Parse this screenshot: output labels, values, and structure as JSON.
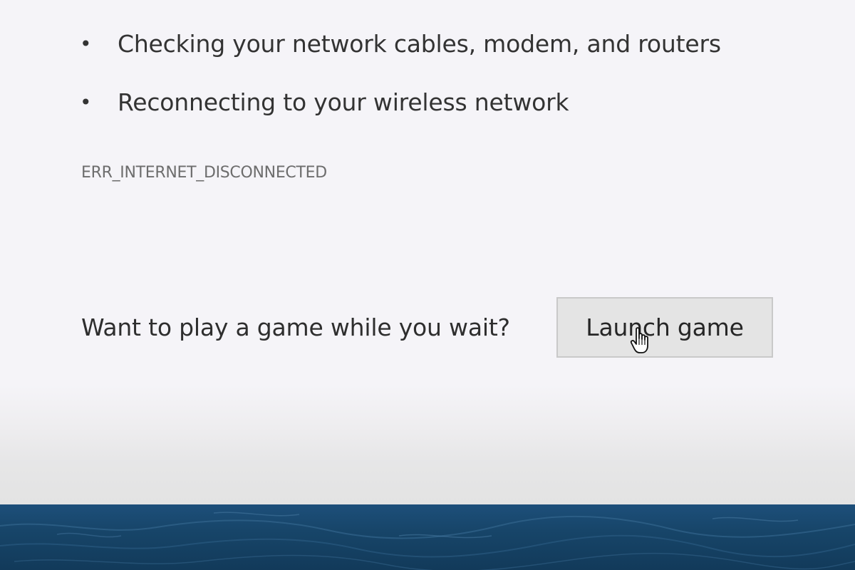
{
  "page": {
    "suggestions": [
      "Checking your network cables, modem, and routers",
      "Reconnecting to your wireless network"
    ],
    "bullet_char": "•",
    "error_code": "ERR_INTERNET_DISCONNECTED",
    "game_prompt": "Want to play a game while you wait?",
    "launch_button_label": "Launch game"
  },
  "colors": {
    "page_background": "#f5f4f8",
    "text": "#333333",
    "error_code_text": "#6d6d6d",
    "button_background": "#e4e4e4",
    "button_border": "#c9c9c9",
    "desktop_water": "#1d4f7a"
  },
  "icons": {
    "cursor": "hand-pointer-icon"
  }
}
